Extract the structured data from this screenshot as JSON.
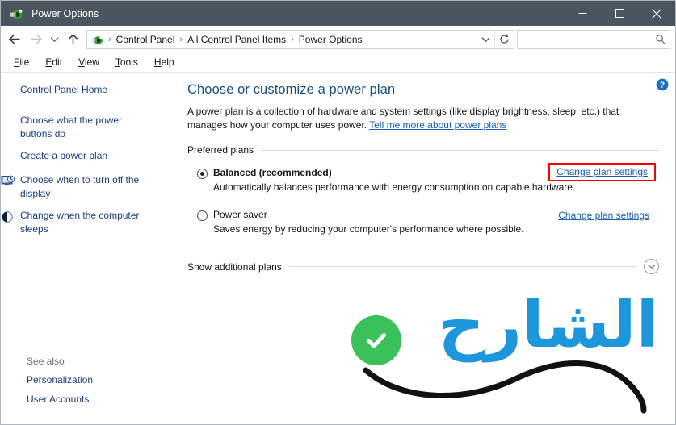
{
  "window": {
    "title": "Power Options",
    "icon": "power-plug-icon",
    "controls": {
      "minimize": "Minimize",
      "maximize": "Maximize",
      "close": "Close"
    }
  },
  "nav": {
    "back": "Back",
    "forward": "Forward",
    "recent": "Recent locations",
    "up": "Up one level",
    "breadcrumbs": [
      "Control Panel",
      "All Control Panel Items",
      "Power Options"
    ],
    "separator": "›",
    "dropdown": "Previous locations",
    "refresh": "Refresh"
  },
  "search": {
    "value": "",
    "placeholder": ""
  },
  "menu": {
    "items": [
      {
        "label": "File",
        "accesskey": "F"
      },
      {
        "label": "Edit",
        "accesskey": "E"
      },
      {
        "label": "View",
        "accesskey": "V"
      },
      {
        "label": "Tools",
        "accesskey": "T"
      },
      {
        "label": "Help",
        "accesskey": "H"
      }
    ]
  },
  "sidebar": {
    "home": "Control Panel Home",
    "items": [
      {
        "label": "Choose what the power buttons do",
        "icon": null
      },
      {
        "label": "Create a power plan",
        "icon": null
      },
      {
        "label": "Choose when to turn off the display",
        "icon": "monitor-clock-icon"
      },
      {
        "label": "Change when the computer sleeps",
        "icon": "moon-sleep-icon"
      }
    ],
    "see_also": {
      "title": "See also",
      "links": [
        "Personalization",
        "User Accounts"
      ]
    }
  },
  "main": {
    "help": "Help",
    "heading": "Choose or customize a power plan",
    "intro_text": "A power plan is a collection of hardware and system settings (like display brightness, sleep, etc.) that manages how your computer uses power.",
    "intro_link": "Tell me more about power plans",
    "group_label": "Preferred plans",
    "plans": [
      {
        "name": "Balanced (recommended)",
        "description": "Automatically balances performance with energy consumption on capable hardware.",
        "selected": true,
        "link": "Change plan settings",
        "highlighted": true
      },
      {
        "name": "Power saver",
        "description": "Saves energy by reducing your computer's performance where possible.",
        "selected": false,
        "link": "Change plan settings",
        "highlighted": false
      }
    ],
    "additional_plans": "Show additional plans",
    "expander": "chevron-down-icon"
  },
  "watermark": {
    "text": "الشارح",
    "badge": "green-check-badge"
  },
  "colors": {
    "titlebar": "#4a5560",
    "heading": "#17507a",
    "link": "#1c5fb0",
    "sidebar_link": "#1c3f7a",
    "highlight_border": "#ff0000",
    "watermark_blue": "#1d96dc",
    "check_green": "#3bc15a"
  }
}
